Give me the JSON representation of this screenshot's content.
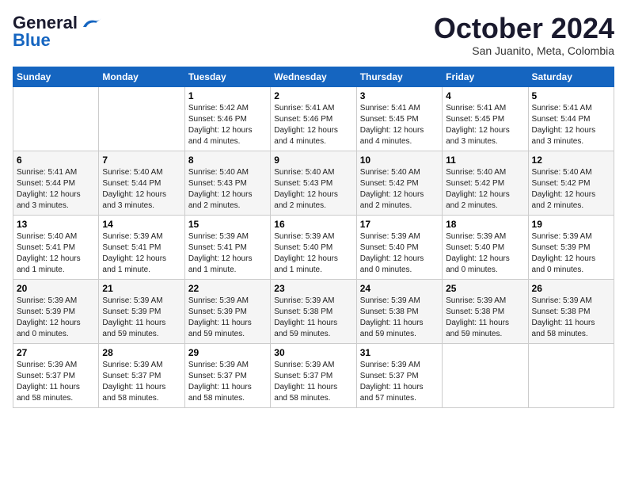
{
  "header": {
    "logo_general": "General",
    "logo_blue": "Blue",
    "month_title": "October 2024",
    "location": "San Juanito, Meta, Colombia"
  },
  "weekdays": [
    "Sunday",
    "Monday",
    "Tuesday",
    "Wednesday",
    "Thursday",
    "Friday",
    "Saturday"
  ],
  "weeks": [
    [
      {
        "day": "",
        "info": ""
      },
      {
        "day": "",
        "info": ""
      },
      {
        "day": "1",
        "info": "Sunrise: 5:42 AM\nSunset: 5:46 PM\nDaylight: 12 hours\nand 4 minutes."
      },
      {
        "day": "2",
        "info": "Sunrise: 5:41 AM\nSunset: 5:46 PM\nDaylight: 12 hours\nand 4 minutes."
      },
      {
        "day": "3",
        "info": "Sunrise: 5:41 AM\nSunset: 5:45 PM\nDaylight: 12 hours\nand 4 minutes."
      },
      {
        "day": "4",
        "info": "Sunrise: 5:41 AM\nSunset: 5:45 PM\nDaylight: 12 hours\nand 3 minutes."
      },
      {
        "day": "5",
        "info": "Sunrise: 5:41 AM\nSunset: 5:44 PM\nDaylight: 12 hours\nand 3 minutes."
      }
    ],
    [
      {
        "day": "6",
        "info": "Sunrise: 5:41 AM\nSunset: 5:44 PM\nDaylight: 12 hours\nand 3 minutes."
      },
      {
        "day": "7",
        "info": "Sunrise: 5:40 AM\nSunset: 5:44 PM\nDaylight: 12 hours\nand 3 minutes."
      },
      {
        "day": "8",
        "info": "Sunrise: 5:40 AM\nSunset: 5:43 PM\nDaylight: 12 hours\nand 2 minutes."
      },
      {
        "day": "9",
        "info": "Sunrise: 5:40 AM\nSunset: 5:43 PM\nDaylight: 12 hours\nand 2 minutes."
      },
      {
        "day": "10",
        "info": "Sunrise: 5:40 AM\nSunset: 5:42 PM\nDaylight: 12 hours\nand 2 minutes."
      },
      {
        "day": "11",
        "info": "Sunrise: 5:40 AM\nSunset: 5:42 PM\nDaylight: 12 hours\nand 2 minutes."
      },
      {
        "day": "12",
        "info": "Sunrise: 5:40 AM\nSunset: 5:42 PM\nDaylight: 12 hours\nand 2 minutes."
      }
    ],
    [
      {
        "day": "13",
        "info": "Sunrise: 5:40 AM\nSunset: 5:41 PM\nDaylight: 12 hours\nand 1 minute."
      },
      {
        "day": "14",
        "info": "Sunrise: 5:39 AM\nSunset: 5:41 PM\nDaylight: 12 hours\nand 1 minute."
      },
      {
        "day": "15",
        "info": "Sunrise: 5:39 AM\nSunset: 5:41 PM\nDaylight: 12 hours\nand 1 minute."
      },
      {
        "day": "16",
        "info": "Sunrise: 5:39 AM\nSunset: 5:40 PM\nDaylight: 12 hours\nand 1 minute."
      },
      {
        "day": "17",
        "info": "Sunrise: 5:39 AM\nSunset: 5:40 PM\nDaylight: 12 hours\nand 0 minutes."
      },
      {
        "day": "18",
        "info": "Sunrise: 5:39 AM\nSunset: 5:40 PM\nDaylight: 12 hours\nand 0 minutes."
      },
      {
        "day": "19",
        "info": "Sunrise: 5:39 AM\nSunset: 5:39 PM\nDaylight: 12 hours\nand 0 minutes."
      }
    ],
    [
      {
        "day": "20",
        "info": "Sunrise: 5:39 AM\nSunset: 5:39 PM\nDaylight: 12 hours\nand 0 minutes."
      },
      {
        "day": "21",
        "info": "Sunrise: 5:39 AM\nSunset: 5:39 PM\nDaylight: 11 hours\nand 59 minutes."
      },
      {
        "day": "22",
        "info": "Sunrise: 5:39 AM\nSunset: 5:39 PM\nDaylight: 11 hours\nand 59 minutes."
      },
      {
        "day": "23",
        "info": "Sunrise: 5:39 AM\nSunset: 5:38 PM\nDaylight: 11 hours\nand 59 minutes."
      },
      {
        "day": "24",
        "info": "Sunrise: 5:39 AM\nSunset: 5:38 PM\nDaylight: 11 hours\nand 59 minutes."
      },
      {
        "day": "25",
        "info": "Sunrise: 5:39 AM\nSunset: 5:38 PM\nDaylight: 11 hours\nand 59 minutes."
      },
      {
        "day": "26",
        "info": "Sunrise: 5:39 AM\nSunset: 5:38 PM\nDaylight: 11 hours\nand 58 minutes."
      }
    ],
    [
      {
        "day": "27",
        "info": "Sunrise: 5:39 AM\nSunset: 5:37 PM\nDaylight: 11 hours\nand 58 minutes."
      },
      {
        "day": "28",
        "info": "Sunrise: 5:39 AM\nSunset: 5:37 PM\nDaylight: 11 hours\nand 58 minutes."
      },
      {
        "day": "29",
        "info": "Sunrise: 5:39 AM\nSunset: 5:37 PM\nDaylight: 11 hours\nand 58 minutes."
      },
      {
        "day": "30",
        "info": "Sunrise: 5:39 AM\nSunset: 5:37 PM\nDaylight: 11 hours\nand 58 minutes."
      },
      {
        "day": "31",
        "info": "Sunrise: 5:39 AM\nSunset: 5:37 PM\nDaylight: 11 hours\nand 57 minutes."
      },
      {
        "day": "",
        "info": ""
      },
      {
        "day": "",
        "info": ""
      }
    ]
  ]
}
